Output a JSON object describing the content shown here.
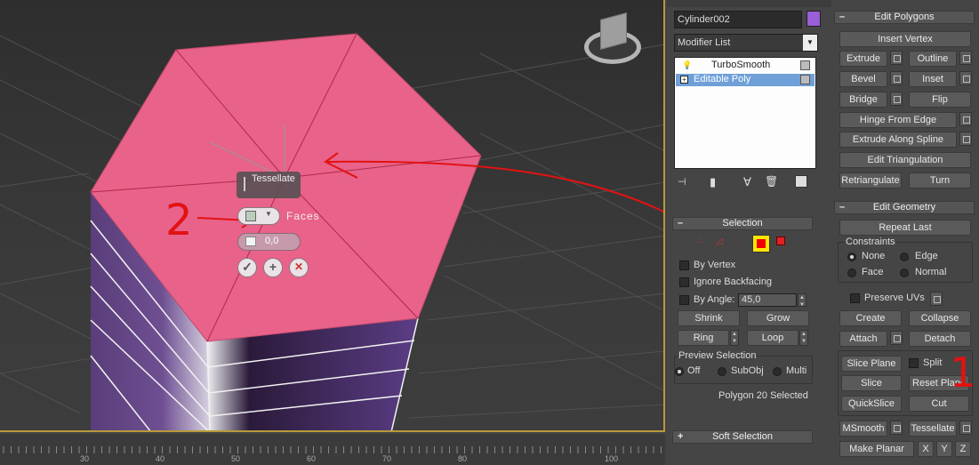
{
  "viewport": {
    "caddy": {
      "title": "Tessellate",
      "mode_label": "Faces",
      "tension_value": "0,0",
      "ok_symbol": "✓",
      "apply_symbol": "+",
      "cancel_symbol": "✕"
    },
    "annotations": {
      "left_number": "2",
      "right_number": "1"
    },
    "viewcube_icon": "viewcube-icon",
    "accent_color": "#e8628a"
  },
  "ruler": {
    "labels": [
      "30",
      "40",
      "50",
      "60",
      "70",
      "80",
      "100"
    ]
  },
  "panel": {
    "object_name": "Cylinder002",
    "object_color": "#9a5ed6",
    "modifier_list_label": "Modifier List",
    "modifier_stack": [
      {
        "label": "TurboSmooth",
        "selected": false
      },
      {
        "label": "Editable Poly",
        "selected": true
      }
    ],
    "selection": {
      "title": "Selection",
      "by_vertex": "By Vertex",
      "ignore_backfacing": "Ignore Backfacing",
      "by_angle": "By Angle:",
      "angle_value": "45,0",
      "shrink": "Shrink",
      "grow": "Grow",
      "ring": "Ring",
      "loop": "Loop",
      "preview_title": "Preview Selection",
      "preview_off": "Off",
      "preview_subobj": "SubObj",
      "preview_multi": "Multi",
      "status": "Polygon 20 Selected"
    },
    "soft_selection": {
      "title": "Soft Selection"
    },
    "edit_polygons": {
      "title": "Edit Polygons",
      "insert_vertex": "Insert Vertex",
      "extrude": "Extrude",
      "outline": "Outline",
      "bevel": "Bevel",
      "inset": "Inset",
      "bridge": "Bridge",
      "flip": "Flip",
      "hinge_from_edge": "Hinge From Edge",
      "extrude_along_spline": "Extrude Along Spline",
      "edit_triangulation": "Edit Triangulation",
      "retriangulate": "Retriangulate",
      "turn": "Turn"
    },
    "edit_geometry": {
      "title": "Edit Geometry",
      "repeat_last": "Repeat Last",
      "constraints_title": "Constraints",
      "none": "None",
      "edge": "Edge",
      "face": "Face",
      "normal": "Normal",
      "preserve_uvs": "Preserve UVs",
      "create": "Create",
      "collapse": "Collapse",
      "attach": "Attach",
      "detach": "Detach",
      "slice_plane": "Slice Plane",
      "split": "Split",
      "slice": "Slice",
      "reset_plane": "Reset Plane",
      "quickslice": "QuickSlice",
      "cut": "Cut",
      "msmooth": "MSmooth",
      "tessellate": "Tessellate",
      "make_planar": "Make Planar",
      "x": "X",
      "y": "Y",
      "z": "Z"
    }
  }
}
